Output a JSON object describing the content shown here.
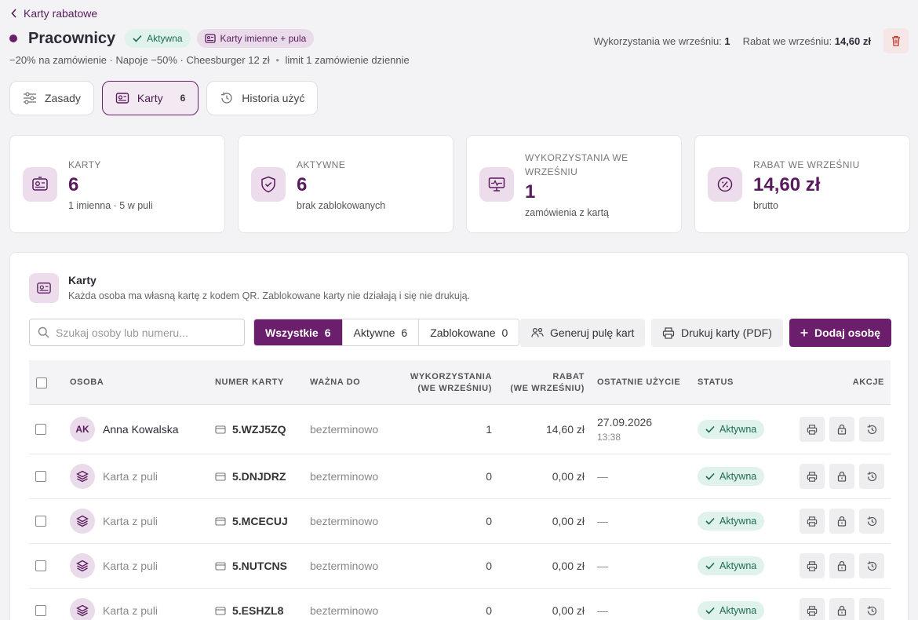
{
  "header": {
    "back_label": "Karty rabatowe",
    "title": "Pracownicy",
    "status_badge": "Aktywna",
    "type_badge": "Karty imienne + pula",
    "usage_label": "Wykorzystania we wrześniu:",
    "usage_value": "1",
    "discount_label": "Rabat we wrześniu:",
    "discount_value": "14,60 zł",
    "rules_summary": "−20% na zamówienie · Napoje −50% · Cheesburger 12 zł",
    "limit_text": "limit 1 zamówienie dziennie",
    "accent_color": "#6a1e6b"
  },
  "tabs": [
    {
      "label": "Zasady",
      "icon": "sliders-icon"
    },
    {
      "label": "Karty",
      "count": "6",
      "icon": "id-card-icon"
    },
    {
      "label": "Historia użyć",
      "icon": "history-icon"
    }
  ],
  "stats": [
    {
      "label": "Karty",
      "value": "6",
      "sub": "1 imienna · 5 w puli",
      "icon": "id-card-icon"
    },
    {
      "label": "Aktywne",
      "value": "6",
      "sub": "brak zablokowanych",
      "icon": "shield-check-icon"
    },
    {
      "label": "Wykorzystania we wrześniu",
      "value": "1",
      "sub": "zamówienia z kartą",
      "icon": "monitor-pulse-icon"
    },
    {
      "label": "Rabat we wrześniu",
      "value": "14,60 zł",
      "sub": "brutto",
      "icon": "discount-icon"
    }
  ],
  "panel": {
    "title": "Karty",
    "description": "Każda osoba ma własną kartę z kodem QR. Zablokowane karty nie działają i się nie drukują.",
    "search_placeholder": "Szukaj osoby lub numeru...",
    "filters": [
      {
        "label": "Wszystkie",
        "count": "6"
      },
      {
        "label": "Aktywne",
        "count": "6"
      },
      {
        "label": "Zablokowane",
        "count": "0"
      }
    ],
    "generate_label": "Generuj pulę kart",
    "print_label": "Drukuj karty (PDF)",
    "add_label": "Dodaj osobę"
  },
  "table": {
    "headers": {
      "person": "Osoba",
      "card_number": "Numer karty",
      "valid_until": "Ważna do",
      "usage_1": "Wykorzystania",
      "usage_2": "(we wrześniu)",
      "discount_1": "Rabat",
      "discount_2": "(we wrześniu)",
      "last_use": "Ostatnie użycie",
      "status": "Status",
      "actions": "Akcje"
    },
    "rows": [
      {
        "initials": "AK",
        "name": "Anna Kowalska",
        "card": "5.WZJ5ZQ",
        "valid": "bezterminowo",
        "usage": "1",
        "discount": "14,60 zł",
        "last_date": "27.09.2026",
        "last_time": "13:38",
        "status": "Aktywna"
      },
      {
        "initials": "",
        "name": "Karta z puli",
        "card": "5.DNJDRZ",
        "valid": "bezterminowo",
        "usage": "0",
        "discount": "0,00 zł",
        "last_date": "—",
        "last_time": "",
        "status": "Aktywna"
      },
      {
        "initials": "",
        "name": "Karta z puli",
        "card": "5.MCECUJ",
        "valid": "bezterminowo",
        "usage": "0",
        "discount": "0,00 zł",
        "last_date": "—",
        "last_time": "",
        "status": "Aktywna"
      },
      {
        "initials": "",
        "name": "Karta z puli",
        "card": "5.NUTCNS",
        "valid": "bezterminowo",
        "usage": "0",
        "discount": "0,00 zł",
        "last_date": "—",
        "last_time": "",
        "status": "Aktywna"
      },
      {
        "initials": "",
        "name": "Karta z puli",
        "card": "5.ESHZL8",
        "valid": "bezterminowo",
        "usage": "0",
        "discount": "0,00 zł",
        "last_date": "—",
        "last_time": "",
        "status": "Aktywna"
      }
    ]
  }
}
